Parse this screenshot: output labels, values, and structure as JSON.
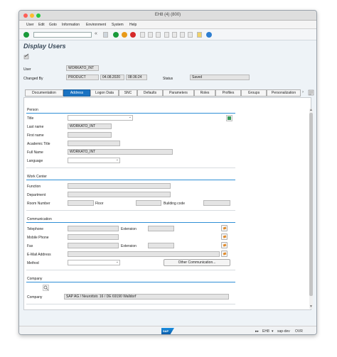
{
  "window": {
    "title": "EH8 (4) (800)"
  },
  "menu": [
    "User",
    "Edit",
    "Goto",
    "Information",
    "Environment",
    "System",
    "Help"
  ],
  "toolbar": {
    "command_value": "",
    "expand_glyph": "«"
  },
  "page_title": "Display Users",
  "header": {
    "user_label": "User",
    "user_value": "WORKATO_INT",
    "changed_by_label": "Changed By",
    "changed_by_value": "PRODUCT",
    "date_value": "04.08.2020",
    "time_value": "08:36:24",
    "status_label": "Status",
    "status_value": "Saved"
  },
  "tabs": [
    "Documentation",
    "Address",
    "Logon Data",
    "SNC",
    "Defaults",
    "Parameters",
    "Roles",
    "Profiles",
    "Groups",
    "Personalization"
  ],
  "active_tab": "Address",
  "person": {
    "title": "Person",
    "title_label": "Title",
    "title_value": "",
    "last_name_label": "Last name",
    "last_name_value": "WORKATO_INT",
    "first_name_label": "First name",
    "first_name_value": "",
    "academic_title_label": "Academic Title",
    "academic_title_value": "",
    "full_name_label": "Full Name",
    "full_name_value": "WORKATO_INT",
    "language_label": "Language",
    "language_value": ""
  },
  "work_center": {
    "title": "Work Center",
    "function_label": "Function",
    "department_label": "Department",
    "room_label": "Room Number",
    "floor_label": "Floor",
    "building_label": "Building code"
  },
  "communication": {
    "title": "Communication",
    "telephone_label": "Telephone",
    "extension_label": "Extension",
    "mobile_label": "Mobile Phone",
    "fax_label": "Fax",
    "fax_extension_label": "Extension",
    "email_label": "E-Mail Address",
    "method_label": "Method",
    "other_button": "Other Communication..."
  },
  "company": {
    "title": "Company",
    "company_label": "Company",
    "company_value": "SAP AG / Neurottstr. 16  / DE 69190 Walldorf"
  },
  "status_bar": {
    "logo": "SAP",
    "system": "EH8",
    "server": "sap-dev",
    "mode": "OVR"
  },
  "colors": {
    "accent": "#1a73c2",
    "group_line": "#2f8fd6",
    "green": "#1a9a3a",
    "orange": "#e89a1a",
    "red": "#d62a2a"
  }
}
